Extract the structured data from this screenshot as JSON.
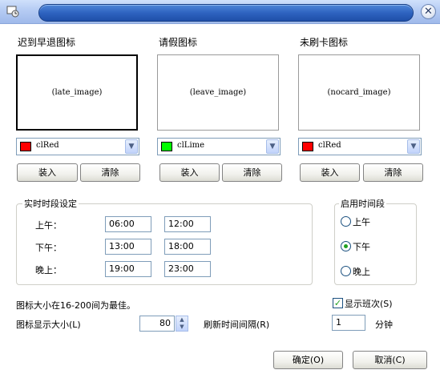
{
  "window": {
    "title": ""
  },
  "icons": {
    "late": {
      "label": "迟到早退图标",
      "image_placeholder": "(late_image)",
      "color_name": "clRed",
      "color": "#ff0000"
    },
    "leave": {
      "label": "请假图标",
      "image_placeholder": "(leave_image)",
      "color_name": "clLime",
      "color": "#00ff00"
    },
    "nocard": {
      "label": "未刷卡图标",
      "image_placeholder": "(nocard_image)",
      "color_name": "clRed",
      "color": "#ff0000"
    },
    "load_label": "装入",
    "clear_label": "清除"
  },
  "realtime": {
    "title": "实时时段设定",
    "rows": [
      {
        "label": "上午：",
        "start": "06:00",
        "end": "12:00"
      },
      {
        "label": "下午：",
        "start": "13:00",
        "end": "18:00"
      },
      {
        "label": "晚上：",
        "start": "19:00",
        "end": "23:00"
      }
    ]
  },
  "enable_period": {
    "title": "启用时间段",
    "options": [
      "上午",
      "下午",
      "晚上"
    ],
    "selected": "下午"
  },
  "hint": "图标大小在16-200间为最佳。",
  "show_shift": {
    "label": "显示班次(S)",
    "checked": true
  },
  "icon_size": {
    "label": "图标显示大小(L)",
    "value": "80"
  },
  "refresh": {
    "label": "刷新时间间隔(R)",
    "value": "1",
    "unit": "分钟"
  },
  "buttons": {
    "ok": "确定(O)",
    "cancel": "取消(C)"
  }
}
